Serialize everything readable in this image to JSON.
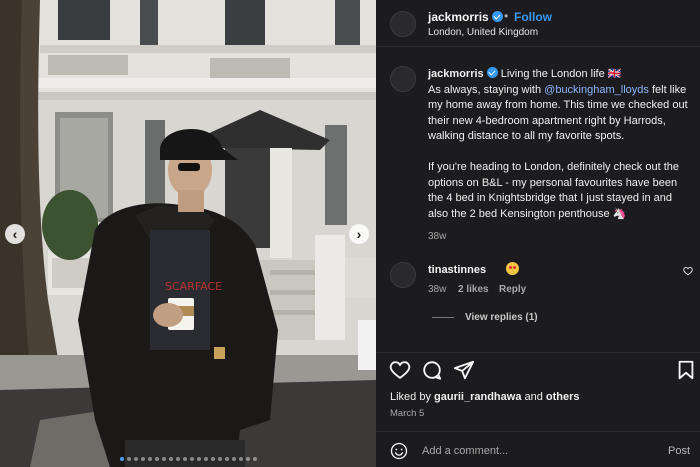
{
  "post": {
    "username": "jackmorris",
    "separator": "•",
    "follow_label": "Follow",
    "location": "London, United Kingdom"
  },
  "caption": {
    "username": "jackmorris",
    "line1": "Living the London life 🇬🇧",
    "text_before_mention": "As always, staying with ",
    "mention": "@buckingham_lloyds",
    "text_after_mention": " felt like my home away from home. This time we checked out their new 4-bedroom apartment right by Harrods, walking distance to all my favorite spots.",
    "paragraph2": "If you're heading to London, definitely check out the options on B&L - my personal favourites have been the 4 bed in Knightsbridge that I just stayed in and also the 2 bed Kensington penthouse 🦄",
    "time": "38w"
  },
  "comment": {
    "username": "tinastinnes",
    "time": "38w",
    "likes": "2 likes",
    "reply_label": "Reply",
    "view_replies": "View replies (1)"
  },
  "actions": {
    "liked_prefix": "Liked by ",
    "liked_user": "gaurii_randhawa",
    "liked_and": " and ",
    "liked_others": "others",
    "date": "March 5",
    "add_comment_placeholder": "Add a comment...",
    "post_label": "Post"
  },
  "photo": {
    "shirt_text": "SCARFACE",
    "carousel_total": 20,
    "carousel_active": 0,
    "prev_icon": "chevron-left-icon",
    "next_icon": "chevron-right-icon"
  },
  "colors": {
    "accent": "#3897f0",
    "mention": "#8db4ff",
    "panel_bg": "#1c1c1e"
  }
}
